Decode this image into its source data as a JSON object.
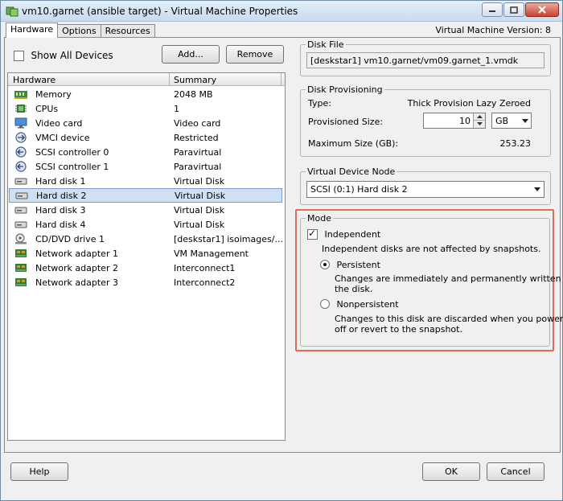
{
  "window": {
    "title": "vm10.garnet (ansible target) - Virtual Machine Properties",
    "version_label": "Virtual Machine Version: 8"
  },
  "tabs": [
    {
      "label": "Hardware",
      "active": true
    },
    {
      "label": "Options",
      "active": false
    },
    {
      "label": "Resources",
      "active": false
    }
  ],
  "hardware": {
    "show_all_devices_label": "Show All Devices",
    "show_all_devices_checked": false,
    "add_label": "Add...",
    "remove_label": "Remove",
    "columns": [
      "Hardware",
      "Summary"
    ],
    "rows": [
      {
        "icon": "memory-icon",
        "name": "Memory",
        "summary": "2048 MB"
      },
      {
        "icon": "cpu-icon",
        "name": "CPUs",
        "summary": "1"
      },
      {
        "icon": "monitor-icon",
        "name": "Video card",
        "summary": "Video card"
      },
      {
        "icon": "vmci-icon",
        "name": "VMCI device",
        "summary": "Restricted"
      },
      {
        "icon": "scsi-icon",
        "name": "SCSI controller 0",
        "summary": "Paravirtual"
      },
      {
        "icon": "scsi-icon",
        "name": "SCSI controller 1",
        "summary": "Paravirtual"
      },
      {
        "icon": "hard-disk-icon",
        "name": "Hard disk 1",
        "summary": "Virtual Disk"
      },
      {
        "icon": "hard-disk-icon",
        "name": "Hard disk 2",
        "summary": "Virtual Disk",
        "selected": true
      },
      {
        "icon": "hard-disk-icon",
        "name": "Hard disk 3",
        "summary": "Virtual Disk"
      },
      {
        "icon": "hard-disk-icon",
        "name": "Hard disk 4",
        "summary": "Virtual Disk"
      },
      {
        "icon": "cd-dvd-icon",
        "name": "CD/DVD drive 1",
        "summary": "[deskstar1] isoimages/..."
      },
      {
        "icon": "network-adapter-icon",
        "name": "Network adapter 1",
        "summary": "VM Management"
      },
      {
        "icon": "network-adapter-icon",
        "name": "Network adapter 2",
        "summary": "Interconnect1"
      },
      {
        "icon": "network-adapter-icon",
        "name": "Network adapter 3",
        "summary": "Interconnect2"
      }
    ]
  },
  "disk_file": {
    "label": "Disk File",
    "value": "[deskstar1] vm10.garnet/vm09.garnet_1.vmdk"
  },
  "disk_provisioning": {
    "label": "Disk Provisioning",
    "type_label": "Type:",
    "type_value": "Thick Provision Lazy Zeroed",
    "provisioned_label": "Provisioned Size:",
    "provisioned_value": "10",
    "unit": "GB",
    "max_label": "Maximum Size (GB):",
    "max_value": "253.23"
  },
  "virtual_device_node": {
    "label": "Virtual Device Node",
    "value": "SCSI (0:1) Hard disk 2"
  },
  "mode": {
    "label": "Mode",
    "independent_label": "Independent",
    "independent_checked": true,
    "independent_desc": "Independent disks are not affected by snapshots.",
    "persistent_label": "Persistent",
    "persistent_checked": true,
    "persistent_desc_1": "Changes are immediately and permanently written to",
    "persistent_desc_2": "the disk.",
    "nonpersistent_label": "Nonpersistent",
    "nonpersistent_checked": false,
    "nonpersistent_desc_1": "Changes to this disk are discarded when you power",
    "nonpersistent_desc_2": "off or revert to the snapshot.",
    "highlight_color": "#e06a5c"
  },
  "footer": {
    "help_label": "Help",
    "ok_label": "OK",
    "cancel_label": "Cancel"
  }
}
